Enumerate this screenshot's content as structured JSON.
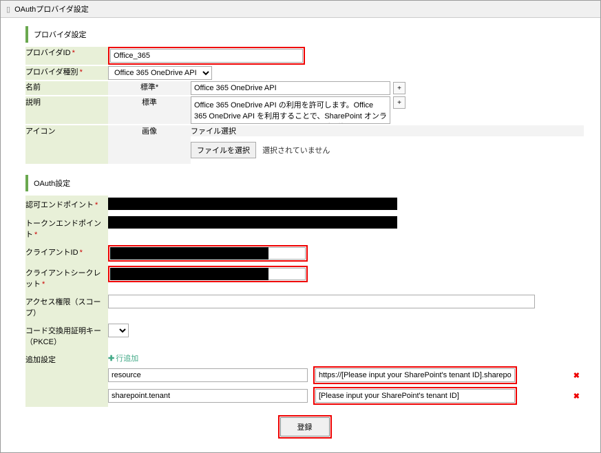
{
  "title": "OAuthプロバイダ設定",
  "provider_section": {
    "header": "プロバイダ設定",
    "provider_id_label": "プロバイダID",
    "provider_id_value": "Office_365",
    "provider_type_label": "プロバイダ種別",
    "provider_type_value": "Office 365 OneDrive API",
    "name_label": "名前",
    "name_locale_label": "標準",
    "name_value": "Office 365 OneDrive API",
    "description_label": "説明",
    "description_locale_label": "標準",
    "description_value": "Office 365 OneDrive API の利用を許可します。Office 365 OneDrive API を利用することで、SharePoint オンライン上のファイルにアクセスすることが可能です。",
    "icon_label": "アイコン",
    "icon_image_label": "画像",
    "icon_file_header": "ファイル選択",
    "icon_file_button": "ファイルを選択",
    "icon_file_status": "選択されていません"
  },
  "oauth_section": {
    "header": "OAuth設定",
    "auth_endpoint_label": "認可エンドポイント",
    "token_endpoint_label": "トークンエンドポイント",
    "client_id_label": "クライアントID",
    "client_secret_label": "クライアントシークレット",
    "scope_label": "アクセス権限（スコープ）",
    "scope_value": "",
    "pkce_label": "コード交換用証明キー（PKCE）",
    "pkce_value": "",
    "advanced_label": "追加設定",
    "add_row_label": "行追加",
    "rows": [
      {
        "key": "resource",
        "value": "https://[Please input your SharePoint's tenant ID].sharepoint.com"
      },
      {
        "key": "sharepoint.tenant",
        "value": "[Please input your SharePoint's tenant ID]"
      }
    ]
  },
  "submit_label": "登録"
}
